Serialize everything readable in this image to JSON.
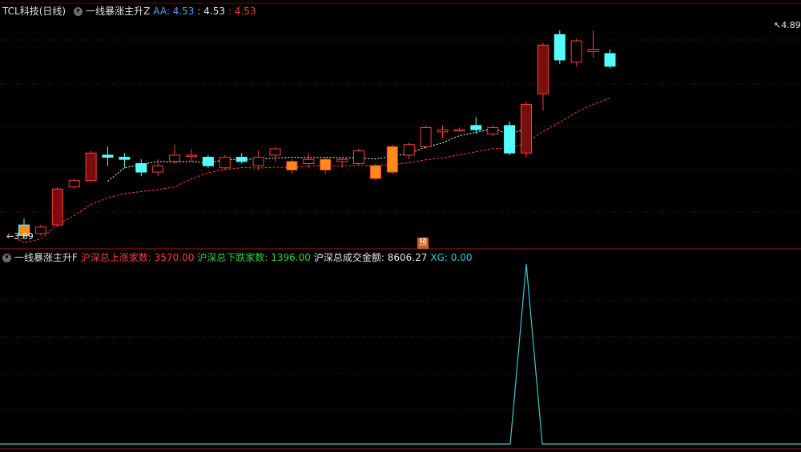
{
  "main_panel": {
    "stock_name": "TCL科技(日线)",
    "indicator_name": "一线暴涨主升Z",
    "aa_label": "AA: 4.53",
    "sep_value": ": 4.53",
    "last_value": ": 4.53",
    "high_price_label": "4.89",
    "low_price_label": "3.89",
    "badge_text": "预"
  },
  "sub_panel": {
    "indicator_name": "一线暴涨主升F",
    "up_label": "沪深总上涨家数: 3570.00",
    "down_label": "沪深总下跌家数: 1396.00",
    "amount_label": "沪深总成交金额: 8606.27",
    "xg_label": "XG: 0.00"
  },
  "colors": {
    "up": "#ff3b3b",
    "down": "#54ffff",
    "highlight_fill": "#ff8c1a",
    "ma_red": "#ff3b3b",
    "ma_white": "#ffffff",
    "sub_line": "#33cccc",
    "grid": "#7a1010"
  },
  "chart_data": {
    "type": "candlestick",
    "y_range": [
      3.85,
      4.92
    ],
    "candles": [
      {
        "o": 3.94,
        "h": 3.97,
        "l": 3.88,
        "c": 3.89,
        "hl": true
      },
      {
        "o": 3.9,
        "h": 3.94,
        "l": 3.89,
        "c": 3.93,
        "down": true
      },
      {
        "o": 3.94,
        "h": 4.12,
        "l": 3.93,
        "c": 4.11
      },
      {
        "o": 4.12,
        "h": 4.16,
        "l": 4.11,
        "c": 4.15
      },
      {
        "o": 4.15,
        "h": 4.29,
        "l": 4.14,
        "c": 4.28
      },
      {
        "o": 4.27,
        "h": 4.31,
        "l": 4.22,
        "c": 4.26,
        "down": true
      },
      {
        "o": 4.26,
        "h": 4.28,
        "l": 4.21,
        "c": 4.25,
        "down": true
      },
      {
        "o": 4.23,
        "h": 4.25,
        "l": 4.17,
        "c": 4.19,
        "down": true
      },
      {
        "o": 4.19,
        "h": 4.25,
        "l": 4.17,
        "c": 4.22
      },
      {
        "o": 4.24,
        "h": 4.32,
        "l": 4.23,
        "c": 4.27
      },
      {
        "o": 4.27,
        "h": 4.3,
        "l": 4.24,
        "c": 4.27
      },
      {
        "o": 4.26,
        "h": 4.27,
        "l": 4.21,
        "c": 4.22,
        "down": true
      },
      {
        "o": 4.21,
        "h": 4.27,
        "l": 4.2,
        "c": 4.26
      },
      {
        "o": 4.26,
        "h": 4.28,
        "l": 4.23,
        "c": 4.24,
        "down": true
      },
      {
        "o": 4.22,
        "h": 4.29,
        "l": 4.2,
        "c": 4.26
      },
      {
        "o": 4.27,
        "h": 4.31,
        "l": 4.24,
        "c": 4.3
      },
      {
        "o": 4.2,
        "h": 4.25,
        "l": 4.18,
        "c": 4.24,
        "hl": true
      },
      {
        "o": 4.23,
        "h": 4.28,
        "l": 4.21,
        "c": 4.25
      },
      {
        "o": 4.2,
        "h": 4.26,
        "l": 4.18,
        "c": 4.25,
        "hl": true
      },
      {
        "o": 4.24,
        "h": 4.26,
        "l": 4.21,
        "c": 4.25
      },
      {
        "o": 4.23,
        "h": 4.3,
        "l": 4.22,
        "c": 4.29
      },
      {
        "o": 4.16,
        "h": 4.23,
        "l": 4.15,
        "c": 4.22,
        "hl": true
      },
      {
        "o": 4.19,
        "h": 4.32,
        "l": 4.18,
        "c": 4.31,
        "hl": true
      },
      {
        "o": 4.27,
        "h": 4.33,
        "l": 4.25,
        "c": 4.32
      },
      {
        "o": 4.31,
        "h": 4.41,
        "l": 4.3,
        "c": 4.4
      },
      {
        "o": 4.38,
        "h": 4.41,
        "l": 4.35,
        "c": 4.39
      },
      {
        "o": 4.39,
        "h": 4.4,
        "l": 4.38,
        "c": 4.39
      },
      {
        "o": 4.41,
        "h": 4.45,
        "l": 4.37,
        "c": 4.39,
        "down": true
      },
      {
        "o": 4.37,
        "h": 4.41,
        "l": 4.36,
        "c": 4.4
      },
      {
        "o": 4.41,
        "h": 4.43,
        "l": 4.27,
        "c": 4.28,
        "down": true
      },
      {
        "o": 4.28,
        "h": 4.52,
        "l": 4.26,
        "c": 4.51
      },
      {
        "o": 4.56,
        "h": 4.8,
        "l": 4.48,
        "c": 4.79
      },
      {
        "o": 4.84,
        "h": 4.86,
        "l": 4.7,
        "c": 4.72,
        "down": true
      },
      {
        "o": 4.71,
        "h": 4.82,
        "l": 4.69,
        "c": 4.81
      },
      {
        "o": 4.76,
        "h": 4.86,
        "l": 4.73,
        "c": 4.77
      },
      {
        "o": 4.75,
        "h": 4.77,
        "l": 4.68,
        "c": 4.69,
        "down": true
      }
    ],
    "sub_series": {
      "name": "XG",
      "spike_index": 30
    }
  }
}
